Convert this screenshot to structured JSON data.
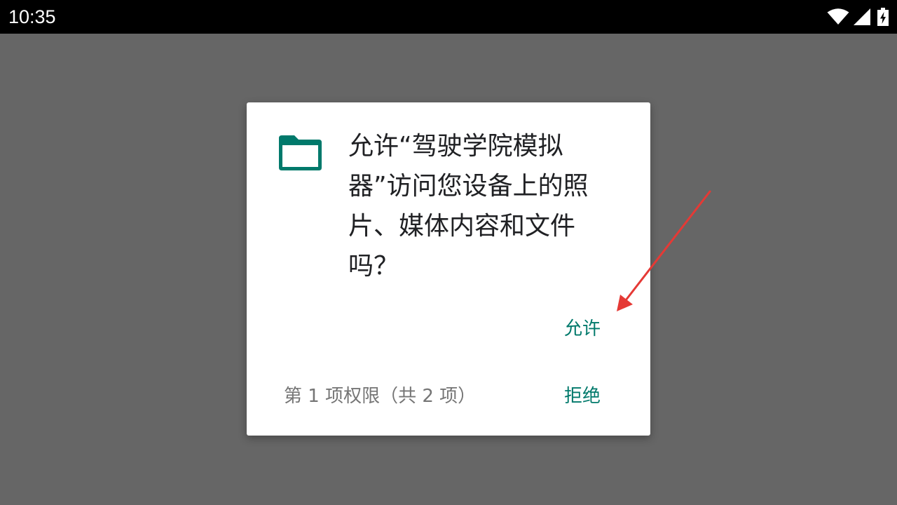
{
  "status_bar": {
    "time": "10:35",
    "icons": [
      "wifi-icon",
      "signal-icon",
      "battery-charging-icon"
    ]
  },
  "dialog": {
    "icon": "folder-icon",
    "message": "允许“驾驶学院模拟器”访问您设备上的照片、媒体内容和文件吗？",
    "allow_label": "允许",
    "deny_label": "拒绝",
    "permission_counter": "第 1 项权限（共 2 项）"
  },
  "annotation": {
    "type": "arrow",
    "color": "#e53935",
    "points_to": "allow-button"
  },
  "colors": {
    "scrim": "#666666",
    "accent": "#00796b",
    "dialog_background": "#ffffff",
    "status_bar": "#000000"
  }
}
